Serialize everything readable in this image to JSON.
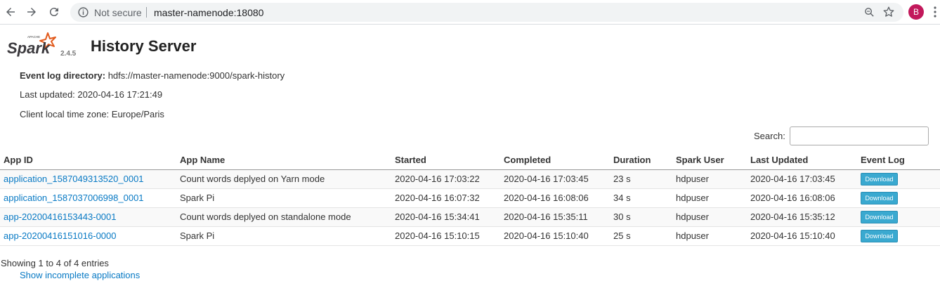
{
  "browser": {
    "security_label": "Not secure",
    "url": "master-namenode:18080",
    "avatar_letter": "B"
  },
  "header": {
    "logo_apache": "APACHE",
    "logo_spark": "Spark",
    "version": "2.4.5",
    "title": "History Server"
  },
  "info": {
    "event_log_label": "Event log directory:",
    "event_log_value": "hdfs://master-namenode:9000/spark-history",
    "last_updated": "Last updated: 2020-04-16 17:21:49",
    "timezone": "Client local time zone: Europe/Paris"
  },
  "search": {
    "label": "Search:",
    "value": ""
  },
  "table": {
    "columns": [
      "App ID",
      "App Name",
      "Started",
      "Completed",
      "Duration",
      "Spark User",
      "Last Updated",
      "Event Log"
    ],
    "rows": [
      {
        "app_id": "application_1587049313520_0001",
        "app_name": "Count words deplyed on Yarn mode",
        "started": "2020-04-16 17:03:22",
        "completed": "2020-04-16 17:03:45",
        "duration": "23 s",
        "user": "hdpuser",
        "last_updated": "2020-04-16 17:03:45",
        "event_log": "Download"
      },
      {
        "app_id": "application_1587037006998_0001",
        "app_name": "Spark Pi",
        "started": "2020-04-16 16:07:32",
        "completed": "2020-04-16 16:08:06",
        "duration": "34 s",
        "user": "hdpuser",
        "last_updated": "2020-04-16 16:08:06",
        "event_log": "Download"
      },
      {
        "app_id": "app-20200416153443-0001",
        "app_name": "Count words deplyed on standalone mode",
        "started": "2020-04-16 15:34:41",
        "completed": "2020-04-16 15:35:11",
        "duration": "30 s",
        "user": "hdpuser",
        "last_updated": "2020-04-16 15:35:12",
        "event_log": "Download"
      },
      {
        "app_id": "app-20200416151016-0000",
        "app_name": "Spark Pi",
        "started": "2020-04-16 15:10:15",
        "completed": "2020-04-16 15:10:40",
        "duration": "25 s",
        "user": "hdpuser",
        "last_updated": "2020-04-16 15:10:40",
        "event_log": "Download"
      }
    ]
  },
  "footer": {
    "showing": "Showing 1 to 4 of 4 entries",
    "incomplete_link": "Show incomplete applications"
  },
  "colors": {
    "link": "#0779c4",
    "download_button": "#3aa9d0",
    "spark_orange": "#e25a1c",
    "avatar": "#c2185b"
  }
}
